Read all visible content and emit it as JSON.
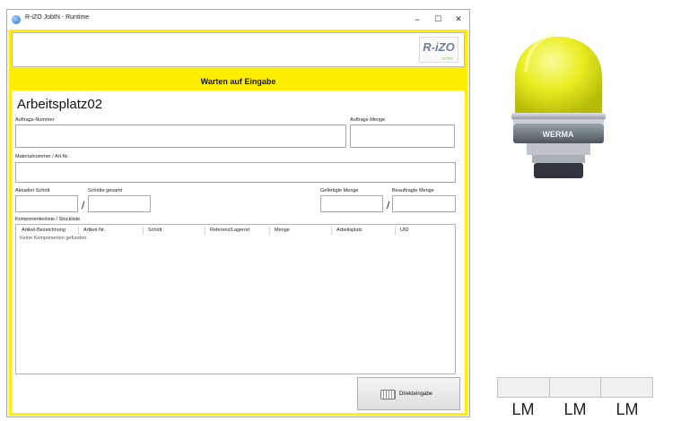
{
  "window": {
    "title": "R-iZO JobIN - Runtime",
    "controls": {
      "minimize": "–",
      "maximize": "☐",
      "close": "✕"
    }
  },
  "header": {
    "logo_text": "R-iZO",
    "logo_subtext": "by light"
  },
  "status": {
    "text": "Warten auf Eingabe",
    "background_color": "#ffee00"
  },
  "workplace": {
    "title": "Arbeitsplatz02"
  },
  "form": {
    "order_number_label": "Auftrags-Nummer",
    "order_number_value": "",
    "order_quantity_label": "Auftrags-Menge",
    "order_quantity_value": "",
    "material_number_label": "Materialnummer / Art.Nr.",
    "material_number_value": "",
    "current_step_label": "Aktueller Schritt",
    "current_step_value": "",
    "steps_total_label": "Schritte gesamt",
    "steps_total_value": "",
    "produced_quantity_label": "Gefertigte Menge",
    "produced_quantity_value": "",
    "commissioned_quantity_label": "Beauftragte Menge",
    "commissioned_quantity_value": "",
    "separator": "/"
  },
  "components": {
    "label": "Komponentenliste / Stückliste",
    "columns": [
      "Artikel-Bezeichnung",
      "Artikel-Nr.",
      "Schritt",
      "Referenz/Lagerort",
      "Menge",
      "Arbeitsplatz",
      "UID"
    ],
    "empty_message": "Keine Komponenten gefunden."
  },
  "direct_input_button": {
    "label": "Direkteingabe",
    "icon": "keyboard-icon"
  },
  "signal_lamp": {
    "color": "yellow",
    "brand": "WERMA",
    "icon": "signal-lamp-icon"
  },
  "lm_indicators": [
    "LM",
    "LM",
    "LM"
  ]
}
